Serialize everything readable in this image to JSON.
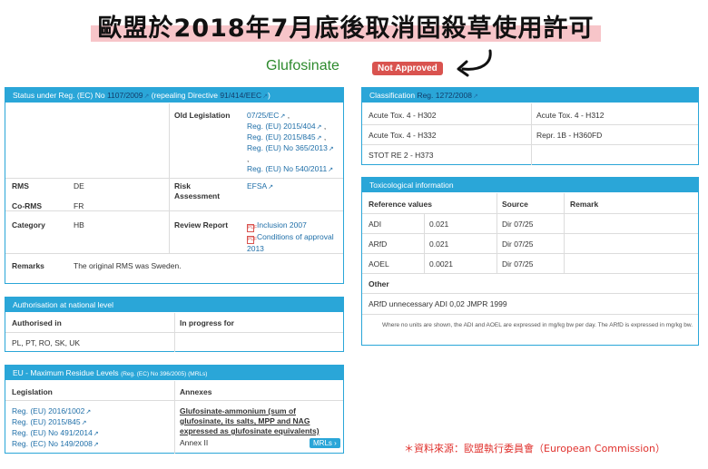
{
  "headline": "歐盟於2018年7月底後取消固殺草使用許可",
  "substance": {
    "name": "Glufosinate",
    "status": "Not Approved"
  },
  "status_panel": {
    "title_prefix": "Status under Reg. (EC) No ",
    "title_link": "1107/2009",
    "title_mid": " (repealing Directive ",
    "title_link2": "91/414/EEC",
    "title_end": ")",
    "old_legislation_label": "Old Legislation",
    "old_legislation": [
      "07/25/EC",
      "Reg. (EU) 2015/404",
      "Reg. (EU) 2015/845",
      "Reg. (EU) No 365/2013",
      "Reg. (EU) No 540/2011"
    ],
    "rms_label": "RMS",
    "rms": "DE",
    "corms_label": "Co-RMS",
    "corms": "FR",
    "risk_label": "Risk Assessment",
    "risk": "EFSA",
    "category_label": "Category",
    "category": "HB",
    "review_label": "Review Report",
    "review": [
      "Inclusion 2007",
      "Conditions of approval 2013"
    ],
    "remarks_label": "Remarks",
    "remarks": "The original RMS was Sweden."
  },
  "auth_panel": {
    "title": "Authorisation at national level",
    "authorised_label": "Authorised in",
    "in_progress_label": "In progress for",
    "authorised": "PL, PT, RO, SK, UK"
  },
  "mrl_panel": {
    "title": "EU - Maximum Residue Levels",
    "title_small": "(Reg. (EC) No 396/2005) (MRLs)",
    "legislation_label": "Legislation",
    "annexes_label": "Annexes",
    "legislation": [
      "Reg. (EU) 2016/1002",
      "Reg. (EU) 2015/845",
      "Reg. (EU) No 491/2014",
      "Reg. (EC) No 149/2008"
    ],
    "residue_def": "Glufosinate-ammonium (sum of glufosinate, its salts, MPP and NAG expressed as glufosinate equivalents)",
    "annex": "Annex II",
    "button": "MRLs ›"
  },
  "class_panel": {
    "title": "Classification ",
    "title_link": "Reg. 1272/2008",
    "items": [
      "Acute Tox. 4 - H302",
      "Acute Tox. 4 - H312",
      "Acute Tox. 4 - H332",
      "Repr. 1B - H360FD",
      "STOT RE 2 - H373"
    ]
  },
  "tox_panel": {
    "title": "Toxicological information",
    "col_ref": "Reference values",
    "col_source": "Source",
    "col_remark": "Remark",
    "rows": [
      {
        "name": "ADI",
        "value": "0.021",
        "source": "Dir 07/25"
      },
      {
        "name": "ARfD",
        "value": "0.021",
        "source": "Dir 07/25"
      },
      {
        "name": "AOEL",
        "value": "0.0021",
        "source": "Dir 07/25"
      }
    ],
    "other_label": "Other",
    "other": "ARfD unnecessary ADI 0,02 JMPR 1999",
    "footnote": "Where no units are shown, the ADI and AOEL are expressed in mg/kg bw per day. The ARfD is expressed in mg/kg bw."
  },
  "source_note": "＊資料來源：歐盟執行委員會（European Commission）"
}
